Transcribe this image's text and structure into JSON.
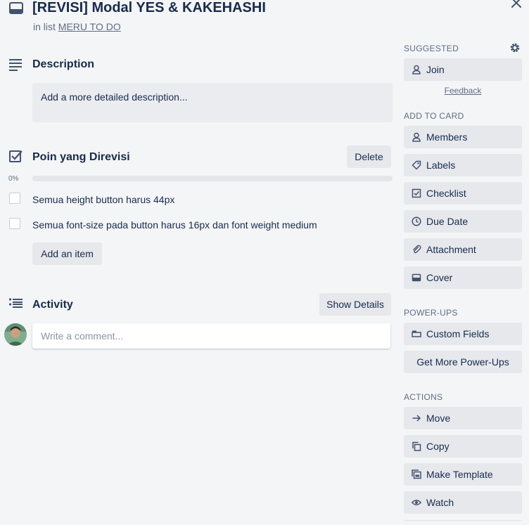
{
  "header": {
    "title": "[REVISI] Modal YES & KAKEHASHI",
    "in_list_prefix": "in list",
    "list_name": "MERU TO DO"
  },
  "description": {
    "heading": "Description",
    "placeholder": "Add a more detailed description..."
  },
  "checklist": {
    "heading": "Poin yang Direvisi",
    "delete_label": "Delete",
    "progress_percent": 0,
    "progress_label": "0%",
    "items": [
      {
        "text": "Semua height button harus 44px",
        "checked": false
      },
      {
        "text": "Semua font-size pada button harus 16px dan font weight medium",
        "checked": false
      }
    ],
    "add_item_label": "Add an item"
  },
  "activity": {
    "heading": "Activity",
    "show_details_label": "Show Details",
    "comment_placeholder": "Write a comment..."
  },
  "sidebar": {
    "suggested": {
      "label": "SUGGESTED",
      "join_label": "Join",
      "feedback_label": "Feedback"
    },
    "add_to_card": {
      "label": "ADD TO CARD",
      "items": [
        {
          "label": "Members",
          "icon": "person-icon"
        },
        {
          "label": "Labels",
          "icon": "tag-icon"
        },
        {
          "label": "Checklist",
          "icon": "checkbox-icon"
        },
        {
          "label": "Due Date",
          "icon": "clock-icon"
        },
        {
          "label": "Attachment",
          "icon": "paperclip-icon"
        },
        {
          "label": "Cover",
          "icon": "cover-icon"
        }
      ]
    },
    "power_ups": {
      "label": "POWER-UPS",
      "custom_fields_label": "Custom Fields",
      "get_more_label": "Get More Power-Ups"
    },
    "actions": {
      "label": "ACTIONS",
      "items": [
        {
          "label": "Move",
          "icon": "arrow-right-icon"
        },
        {
          "label": "Copy",
          "icon": "copy-icon"
        },
        {
          "label": "Make Template",
          "icon": "template-icon"
        },
        {
          "label": "Watch",
          "icon": "eye-icon"
        }
      ]
    }
  },
  "colors": {
    "background": "#f4f5f7",
    "button_bg": "#e6e8ec",
    "text": "#172b4d",
    "muted_text": "#5e6c84"
  }
}
